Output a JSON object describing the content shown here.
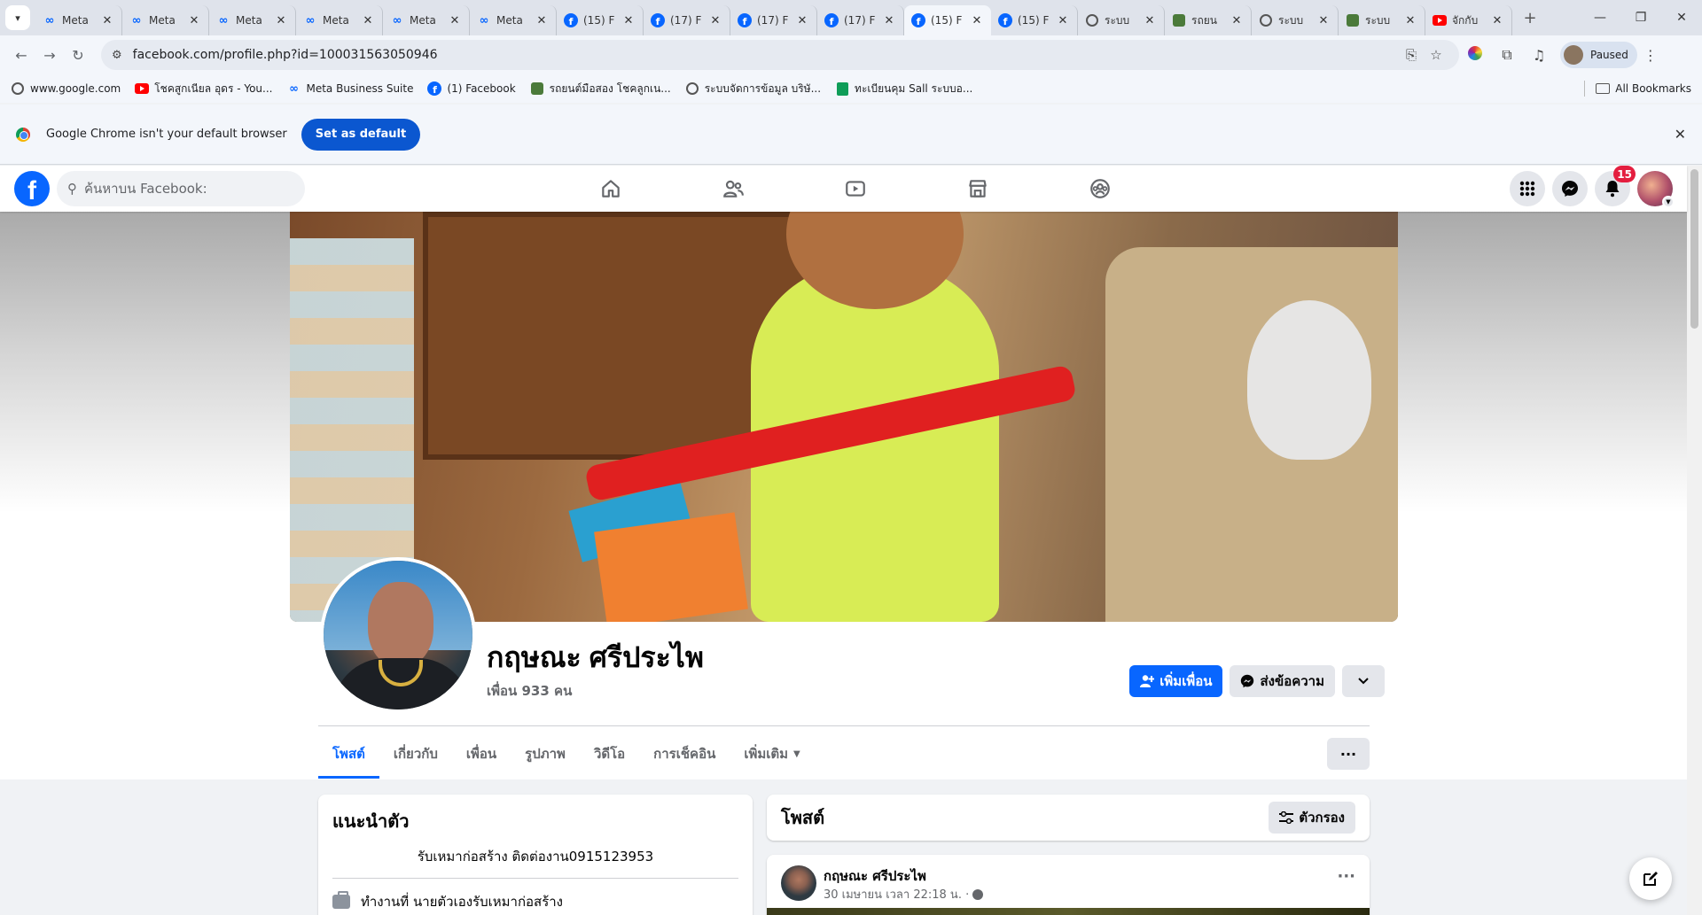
{
  "browser": {
    "tabs": [
      {
        "title": "Meta",
        "icon": "meta-icon"
      },
      {
        "title": "Meta",
        "icon": "meta-icon"
      },
      {
        "title": "Meta",
        "icon": "meta-icon"
      },
      {
        "title": "Meta",
        "icon": "meta-icon"
      },
      {
        "title": "Meta",
        "icon": "meta-icon"
      },
      {
        "title": "Meta",
        "icon": "meta-icon"
      },
      {
        "title": "(15) F",
        "icon": "facebook-icon"
      },
      {
        "title": "(17) F",
        "icon": "facebook-icon"
      },
      {
        "title": "(17) F",
        "icon": "facebook-icon"
      },
      {
        "title": "(17) F",
        "icon": "facebook-icon"
      },
      {
        "title": "(15) F",
        "icon": "facebook-icon",
        "active": true
      },
      {
        "title": "(15) F",
        "icon": "facebook-icon"
      },
      {
        "title": "ระบบ",
        "icon": "globe-icon"
      },
      {
        "title": "รถยน",
        "icon": "plant-icon"
      },
      {
        "title": "ระบบ",
        "icon": "globe-icon"
      },
      {
        "title": "ระบบ",
        "icon": "plant-icon"
      },
      {
        "title": "จักกับ",
        "icon": "youtube-icon"
      }
    ],
    "url": "facebook.com/profile.php?id=100031563050946",
    "profile_status": "Paused",
    "bookmarks": [
      {
        "label": "www.google.com",
        "icon": "globe-icon"
      },
      {
        "label": "โชคสูกเนียล อุดร - You...",
        "icon": "youtube-icon"
      },
      {
        "label": "Meta Business Suite",
        "icon": "meta-icon"
      },
      {
        "label": "(1) Facebook",
        "icon": "facebook-icon"
      },
      {
        "label": "รถยนต์มือสอง โชคลูกเน...",
        "icon": "plant-icon"
      },
      {
        "label": "ระบบจัดการข้อมูล บริษั...",
        "icon": "globe-icon"
      },
      {
        "label": "ทะเบียนคุม Sall ระบบอ...",
        "icon": "sheets-icon"
      }
    ],
    "all_bookmarks": "All Bookmarks",
    "infobar": {
      "message": "Google Chrome isn't your default browser",
      "button": "Set as default"
    }
  },
  "facebook": {
    "search_placeholder": "ค้นหาบน Facebook:",
    "notification_count": "15",
    "profile": {
      "name": "กฤษณะ ศรีประไพ",
      "friends": "เพื่อน 933 คน",
      "add_friend": "เพิ่มเพื่อน",
      "message": "ส่งข้อความ"
    },
    "tabs": [
      "โพสต์",
      "เกี่ยวกับ",
      "เพื่อน",
      "รูปภาพ",
      "วิดีโอ",
      "การเช็คอิน",
      "เพิ่มเติม"
    ],
    "intro": {
      "title": "แนะนำตัว",
      "bio": "รับเหมาก่อสร้าง ติดต่องาน0915123953",
      "work": "ทำงานที่ นายตัวเองรับเหมาก่อสร้าง"
    },
    "posts": {
      "title": "โพสต์",
      "filter": "ตัวกรอง",
      "first": {
        "author": "กฤษณะ ศรีประไพ",
        "time": "30 เมษายน เวลา 22:18 น. ·"
      }
    }
  },
  "colors": {
    "fb_blue": "#0866ff",
    "notification_red": "#e41e3f",
    "chrome_button": "#0b57d0"
  }
}
